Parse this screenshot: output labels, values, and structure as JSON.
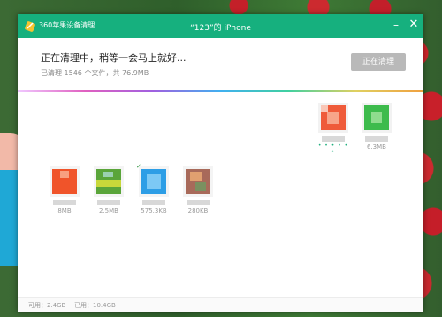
{
  "window": {
    "app_name": "360苹果设备清理",
    "device_title": "“123”的 iPhone",
    "minimize_glyph": "–",
    "close_glyph": "✕"
  },
  "status": {
    "title": "正在清理中，稍等一会马上就好...",
    "subtitle": "已清理 1546 个文件，共 76.9MB",
    "button_label": "正在清理"
  },
  "apps_top": [
    {
      "icon": "app-icon-orange-red",
      "size": "",
      "color": "#ef5b3a",
      "status_dots": "• • • • • •"
    },
    {
      "icon": "app-icon-green",
      "size": "6.3MB",
      "color": "#3dbb4c"
    }
  ],
  "apps_bottom": [
    {
      "icon": "app-icon-orange",
      "size": "8MB",
      "color": "#f0542a"
    },
    {
      "icon": "app-icon-green-yellow",
      "size": "2.5MB",
      "color": "#5aa53a"
    },
    {
      "icon": "app-icon-blue",
      "size": "575.3KB",
      "color": "#2d9ee6",
      "checked": "✓"
    },
    {
      "icon": "app-icon-brown",
      "size": "280KB",
      "color": "#a86a5a"
    }
  ],
  "footer": {
    "available": "可用：2.4GB",
    "used": "已用：10.4GB"
  },
  "colors": {
    "accent": "#16b07e",
    "button_disabled": "#b9b9b9"
  }
}
